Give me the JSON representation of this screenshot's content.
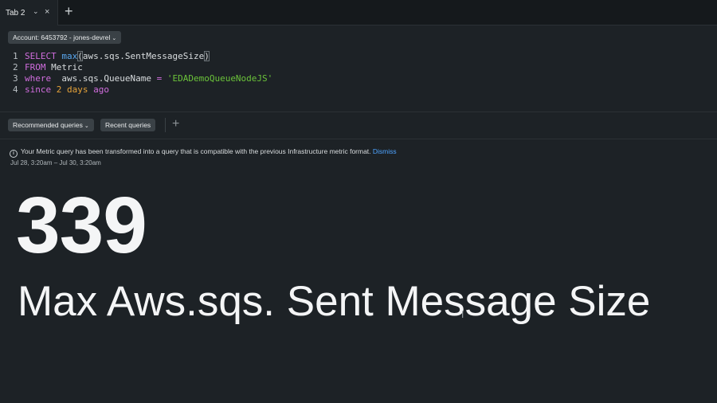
{
  "tabs": [
    {
      "label": "Tab 2"
    }
  ],
  "account": {
    "label": "Account: 6453792 - jones-devrel"
  },
  "query": {
    "line1": {
      "num": "1",
      "select": "SELECT",
      "fn": "max",
      "p_open": "(",
      "arg": "aws.sqs.SentMessageSize",
      "p_close": ")"
    },
    "line2": {
      "num": "2",
      "from": "FROM",
      "table": "Metric"
    },
    "line3": {
      "num": "3",
      "where": "where",
      "field": "aws.sqs.QueueName",
      "eq": "=",
      "value": "'EDADemoQueueNodeJS'"
    },
    "line4": {
      "num": "4",
      "since": "since",
      "amount": "2",
      "unit": "days",
      "ago": "ago"
    }
  },
  "querybar": {
    "recommended": "Recommended queries",
    "recent": "Recent queries"
  },
  "notice": {
    "text": "Your Metric query has been transformed into a query that is compatible with the previous Infrastructure metric format.",
    "dismiss": "Dismiss"
  },
  "result": {
    "date_range": "Jul 28, 3:20am – Jul 30, 3:20am",
    "value": "339",
    "label": "Max Aws.sqs. Sent Message Size"
  }
}
